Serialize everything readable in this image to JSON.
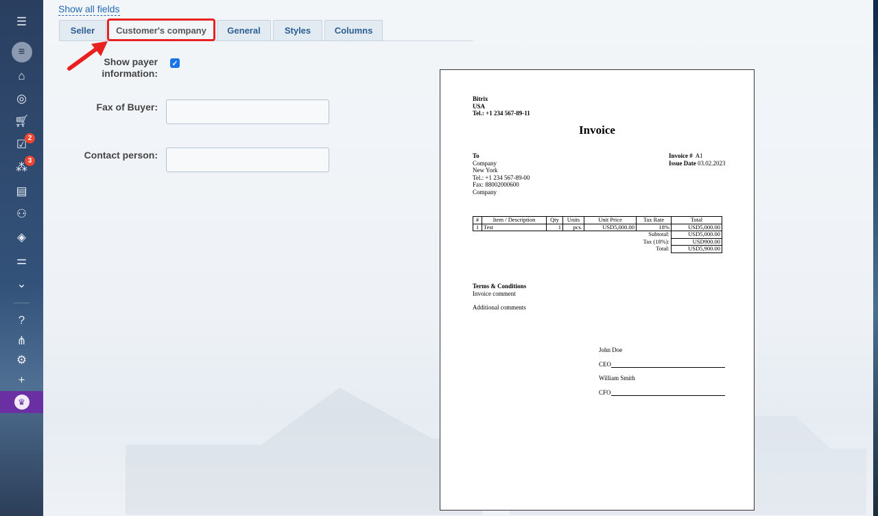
{
  "sidebar": {
    "items": [
      {
        "icon": "menu-icon"
      },
      {
        "icon": "filter-icon"
      },
      {
        "icon": "building-icon"
      },
      {
        "icon": "target-icon"
      },
      {
        "icon": "cart-icon"
      },
      {
        "icon": "tasks-icon",
        "badge": "2"
      },
      {
        "icon": "network-icon",
        "badge": "3"
      },
      {
        "icon": "contact-card-icon"
      },
      {
        "icon": "robot-icon"
      },
      {
        "icon": "box-icon"
      },
      {
        "icon": "sliders-icon"
      },
      {
        "icon": "chevron-down-icon"
      },
      {
        "icon": "help-icon"
      },
      {
        "icon": "sitemap-icon"
      },
      {
        "icon": "gear-icon"
      },
      {
        "icon": "plus-icon"
      },
      {
        "icon": "crown-icon"
      }
    ]
  },
  "form": {
    "show_all_fields": "Show all fields",
    "tabs": [
      "Seller",
      "Customer's company",
      "General",
      "Styles",
      "Columns"
    ],
    "active_tab": "Customer's company",
    "show_payer_label_line1": "Show payer",
    "show_payer_label_line2": "information:",
    "show_payer_checked": true,
    "fax_label": "Fax of Buyer:",
    "fax_value": "",
    "contact_label": "Contact person:",
    "contact_value": ""
  },
  "colors": {
    "highlight": "#e8201f",
    "checkbox": "#1a73e8",
    "tab_text": "#2d5e91",
    "link": "#2067b0"
  },
  "invoice": {
    "seller_name": "Bitrix",
    "seller_country": "USA",
    "seller_phone": "Tel.: +1 234 567-89-11",
    "title": "Invoice",
    "to_label": "To",
    "to_company": "Company",
    "to_city": "New York",
    "to_phone": "Tel.: +1 234 567-89-00",
    "to_fax": "Fax: 88002000600",
    "to_company2": "Company",
    "invoice_no_label": "Invoice #",
    "invoice_no": "A1",
    "issue_date_label": "Issue Date",
    "issue_date": "03.02.2023",
    "table_headers": [
      "#",
      "Item / Description",
      "Qty",
      "Units",
      "Unit Price",
      "Tax Rate",
      "Total"
    ],
    "rows": [
      {
        "num": "1",
        "item": "Test",
        "qty": "1",
        "units": "pcs.",
        "price": "USD5,000.00",
        "tax": "18%",
        "total": "USD5,000.00"
      }
    ],
    "subtotal_label": "Subtotal:",
    "subtotal": "USD5,000.00",
    "tax_label": "Tax (18%):",
    "tax": "USD900.00",
    "total_label": "Total:",
    "total": "USD5,900.00",
    "terms_title": "Terms & Conditions",
    "terms_comment": "Invoice comment",
    "additional_comments": "Additional comments",
    "signer1_name": "John Doe",
    "signer1_role": "CEO",
    "signer2_name": "William Smith",
    "signer2_role": "CFO"
  }
}
